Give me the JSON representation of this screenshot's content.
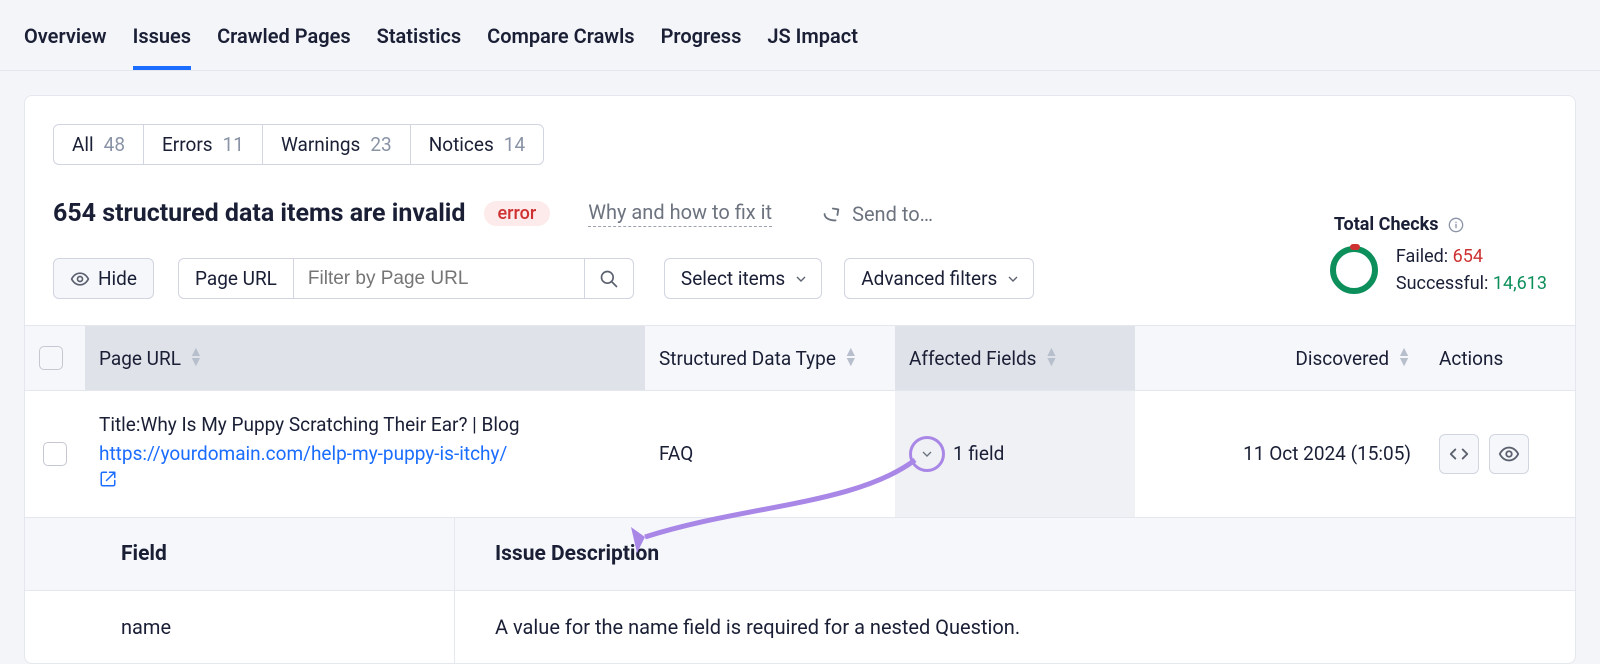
{
  "topTabs": {
    "overview": "Overview",
    "issues": "Issues",
    "crawled": "Crawled Pages",
    "statistics": "Statistics",
    "compare": "Compare Crawls",
    "progress": "Progress",
    "jsimpact": "JS Impact"
  },
  "filterPills": {
    "all": {
      "label": "All",
      "count": "48"
    },
    "errors": {
      "label": "Errors",
      "count": "11"
    },
    "warnings": {
      "label": "Warnings",
      "count": "23"
    },
    "notices": {
      "label": "Notices",
      "count": "14"
    }
  },
  "issue": {
    "title": "654 structured data items are invalid",
    "badge": "error",
    "helpLink": "Why and how to fix it",
    "sendTo": "Send to…"
  },
  "controls": {
    "hide": "Hide",
    "filterLabel": "Page URL",
    "filterPlaceholder": "Filter by Page URL",
    "selectItems": "Select items",
    "advancedFilters": "Advanced filters"
  },
  "stats": {
    "title": "Total Checks",
    "failedLabel": "Failed:",
    "failedCount": "654",
    "successLabel": "Successful:",
    "successCount": "14,613"
  },
  "columns": {
    "pageUrl": "Page URL",
    "dataType": "Structured Data Type",
    "affected": "Affected Fields",
    "discovered": "Discovered",
    "actions": "Actions"
  },
  "row": {
    "titlePrefix": "Title:",
    "title": "Why Is My Puppy Scratching Their Ear? | Blog",
    "url": "https://yourdomain.com/help-my-puppy-is-itchy/",
    "dataType": "FAQ",
    "affected": "1 field",
    "discovered": "11 Oct 2024 (15:05)"
  },
  "detail": {
    "fieldHeader": "Field",
    "descHeader": "Issue Description",
    "fieldName": "name",
    "issueDesc": "A value for the name field is required for a nested Question."
  },
  "icons": {
    "eye": "eye-icon",
    "search": "search-icon",
    "chevronDown": "chevron-down-icon",
    "info": "info-icon",
    "shareArrow": "share-arrow-icon",
    "extLink": "external-link-icon",
    "code": "code-icon"
  }
}
